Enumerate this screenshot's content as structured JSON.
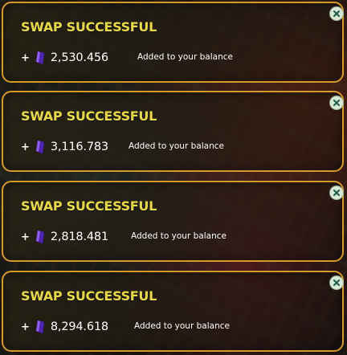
{
  "colors": {
    "border": "#d69a2a",
    "title": "#e8d94a",
    "text": "#ffffff",
    "gem": "#6b3bd6",
    "close_bg": "#d8e6d4",
    "close_x": "#1d5a4a"
  },
  "notifications": [
    {
      "title": "SWAP SUCCESSFUL",
      "plus": "+",
      "amount": "2,530.456",
      "message": "Added to your balance",
      "icon": "purple-gem-icon",
      "close_icon": "close-icon"
    },
    {
      "title": "SWAP SUCCESSFUL",
      "plus": "+",
      "amount": "3,116.783",
      "message": "Added to your balance",
      "icon": "purple-gem-icon",
      "close_icon": "close-icon"
    },
    {
      "title": "SWAP SUCCESSFUL",
      "plus": "+",
      "amount": "2,818.481",
      "message": "Added to your balance",
      "icon": "purple-gem-icon",
      "close_icon": "close-icon"
    },
    {
      "title": "SWAP SUCCESSFUL",
      "plus": "+",
      "amount": "8,294.618",
      "message": "Added to your balance",
      "icon": "purple-gem-icon",
      "close_icon": "close-icon"
    }
  ]
}
